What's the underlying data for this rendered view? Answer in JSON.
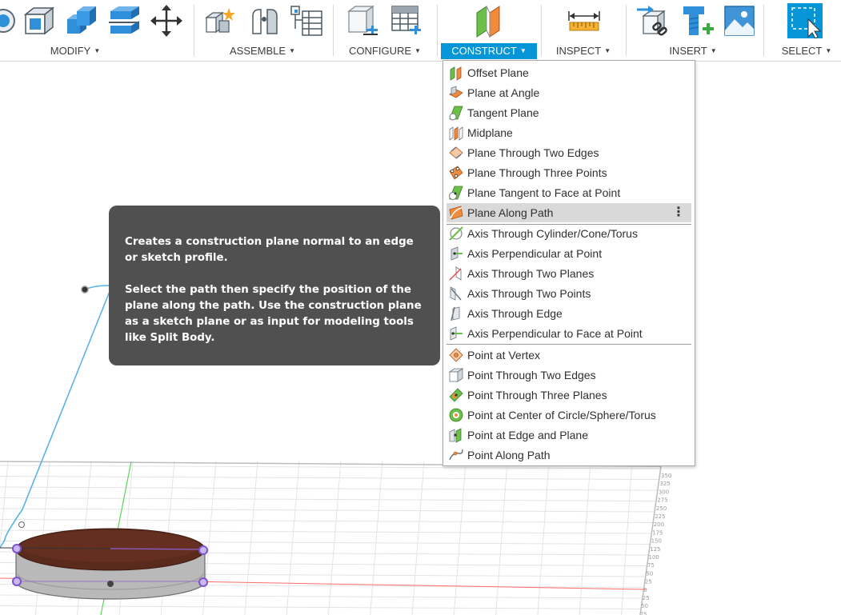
{
  "toolbar": {
    "groups": {
      "modify": "MODIFY",
      "assemble": "ASSEMBLE",
      "configure": "CONFIGURE",
      "construct": "CONSTRUCT",
      "inspect": "INSPECT",
      "insert": "INSERT",
      "select": "SELECT"
    },
    "active_group": "CONSTRUCT"
  },
  "menu": {
    "items": [
      {
        "label": "Offset Plane",
        "icon": "offset-plane-icon"
      },
      {
        "label": "Plane at Angle",
        "icon": "plane-at-angle-icon"
      },
      {
        "label": "Tangent Plane",
        "icon": "tangent-plane-icon"
      },
      {
        "label": "Midplane",
        "icon": "midplane-icon"
      },
      {
        "label": "Plane Through Two Edges",
        "icon": "plane-two-edges-icon"
      },
      {
        "label": "Plane Through Three Points",
        "icon": "plane-three-points-icon"
      },
      {
        "label": "Plane Tangent to Face at Point",
        "icon": "plane-tangent-face-icon"
      },
      {
        "label": "Plane Along Path",
        "icon": "plane-along-path-icon"
      },
      {
        "label": "Axis Through Cylinder/Cone/Torus",
        "icon": "axis-cylinder-icon"
      },
      {
        "label": "Axis Perpendicular at Point",
        "icon": "axis-perpendicular-point-icon"
      },
      {
        "label": "Axis Through Two Planes",
        "icon": "axis-two-planes-icon"
      },
      {
        "label": "Axis Through Two Points",
        "icon": "axis-two-points-icon"
      },
      {
        "label": "Axis Through Edge",
        "icon": "axis-edge-icon"
      },
      {
        "label": "Axis Perpendicular to Face at Point",
        "icon": "axis-perpendicular-face-icon"
      },
      {
        "label": "Point at Vertex",
        "icon": "point-vertex-icon"
      },
      {
        "label": "Point Through Two Edges",
        "icon": "point-two-edges-icon"
      },
      {
        "label": "Point Through Three Planes",
        "icon": "point-three-planes-icon"
      },
      {
        "label": "Point at Center of Circle/Sphere/Torus",
        "icon": "point-center-icon"
      },
      {
        "label": "Point at Edge and Plane",
        "icon": "point-edge-plane-icon"
      },
      {
        "label": "Point Along Path",
        "icon": "point-along-path-icon"
      }
    ],
    "highlighted": "Plane Along Path"
  },
  "tooltip": {
    "line1": "Creates a construction plane normal to an edge or sketch profile.",
    "line2": "Select the path then specify the position of the plane along the path. Use the construction plane as a sketch plane or as input for modeling tools like Split Body."
  },
  "ruler": {
    "labels": [
      "350",
      "325",
      "300",
      "275",
      "250",
      "225",
      "200",
      "175",
      "150",
      "125",
      "100",
      "75",
      "50",
      "25",
      "0",
      "25",
      "50",
      "75"
    ]
  },
  "colors": {
    "accent": "#0696d7",
    "tooltip_bg": "#505050",
    "menu_highlight": "#d9d9d9",
    "disk_top": "#5a2a1c",
    "path": "#55b4e6"
  }
}
